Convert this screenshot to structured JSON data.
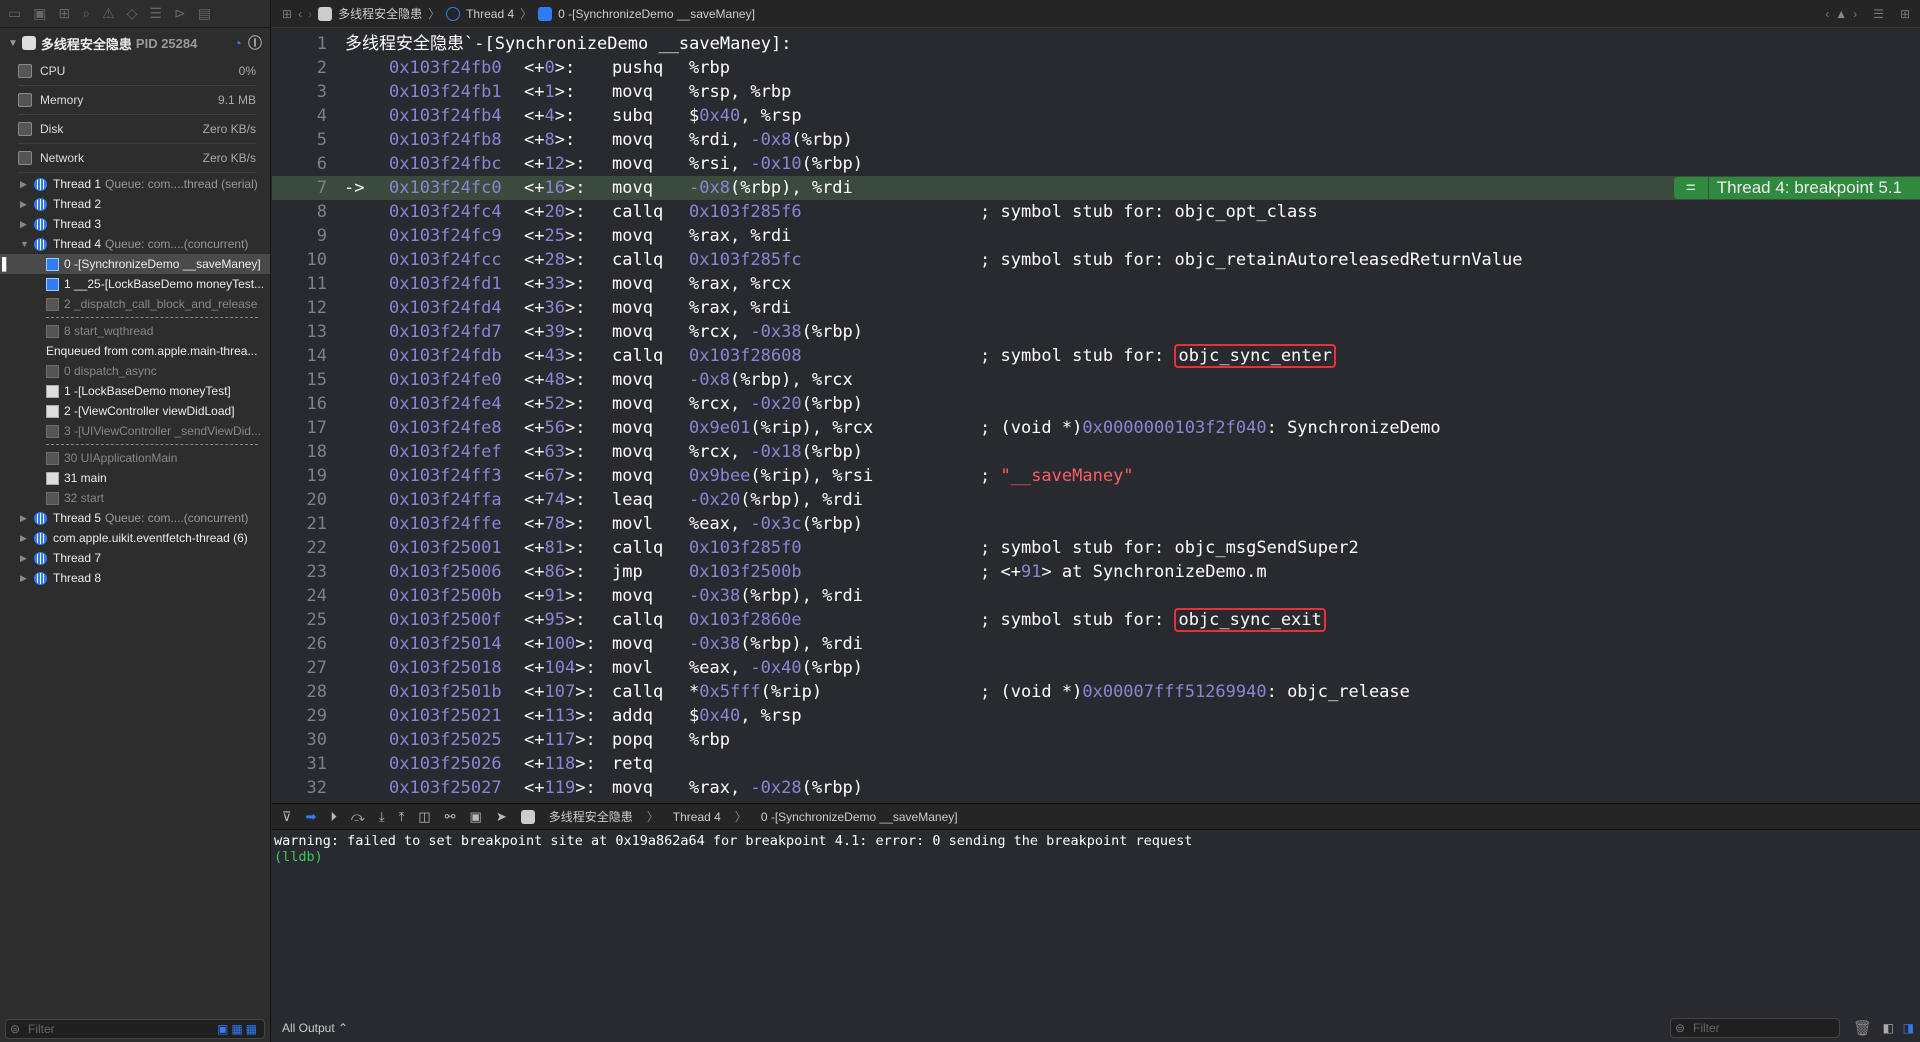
{
  "process": {
    "name": "多线程安全隐患",
    "pid": "PID 25284"
  },
  "gauges": [
    {
      "label": "CPU",
      "value": "0%"
    },
    {
      "label": "Memory",
      "value": "9.1 MB"
    },
    {
      "label": "Disk",
      "value": "Zero KB/s"
    },
    {
      "label": "Network",
      "value": "Zero KB/s"
    }
  ],
  "threads": [
    {
      "kind": "thread",
      "label": "Thread 1",
      "queue": "Queue: com....thread (serial)",
      "expanded": false
    },
    {
      "kind": "thread",
      "label": "Thread 2",
      "queue": "",
      "expanded": false
    },
    {
      "kind": "thread",
      "label": "Thread 3",
      "queue": "",
      "expanded": false
    },
    {
      "kind": "thread",
      "label": "Thread 4",
      "queue": "Queue: com....(concurrent)",
      "expanded": true
    },
    {
      "kind": "frame",
      "type": "user",
      "label": "0 -[SynchronizeDemo __saveManey]",
      "selected": true
    },
    {
      "kind": "frame",
      "type": "user",
      "label": "1 __25-[LockBaseDemo moneyTest..."
    },
    {
      "kind": "frame",
      "type": "sys",
      "label": "2 _dispatch_call_block_and_release"
    },
    {
      "kind": "dash"
    },
    {
      "kind": "frame",
      "type": "sys",
      "label": "8 start_wqthread"
    },
    {
      "kind": "enq",
      "label": "Enqueued from com.apple.main-threa..."
    },
    {
      "kind": "frame",
      "type": "sys",
      "label": "0 dispatch_async"
    },
    {
      "kind": "frame",
      "type": "app",
      "label": "1 -[LockBaseDemo moneyTest]"
    },
    {
      "kind": "frame",
      "type": "app",
      "label": "2 -[ViewController viewDidLoad]"
    },
    {
      "kind": "frame",
      "type": "sys",
      "label": "3 -[UIViewController _sendViewDid..."
    },
    {
      "kind": "dash"
    },
    {
      "kind": "frame",
      "type": "sys",
      "label": "30 UIApplicationMain"
    },
    {
      "kind": "frame",
      "type": "app",
      "label": "31 main"
    },
    {
      "kind": "frame",
      "type": "sys",
      "label": "32 start"
    },
    {
      "kind": "thread",
      "label": "Thread 5",
      "queue": "Queue: com....(concurrent)",
      "expanded": false
    },
    {
      "kind": "thread",
      "label": "com.apple.uikit.eventfetch-thread (6)",
      "queue": "",
      "expanded": false
    },
    {
      "kind": "thread",
      "label": "Thread 7",
      "queue": "",
      "expanded": false
    },
    {
      "kind": "thread",
      "label": "Thread 8",
      "queue": "",
      "expanded": false
    }
  ],
  "sidebar_filter_placeholder": "Filter",
  "breadcrumb": {
    "app": "多线程安全隐患",
    "thread": "Thread 4",
    "frame": "0 -[SynchronizeDemo __saveManey]"
  },
  "code": {
    "header": "多线程安全隐患`-[SynchronizeDemo __saveManey]:",
    "current_line": 7,
    "breakpoint_label": "Thread 4: breakpoint 5.1",
    "lines": [
      [
        "0x103f24fb0",
        "<+0>:",
        "pushq",
        "%rbp",
        ""
      ],
      [
        "0x103f24fb1",
        "<+1>:",
        "movq",
        "%rsp, %rbp",
        ""
      ],
      [
        "0x103f24fb4",
        "<+4>:",
        "subq",
        "$0x40, %rsp",
        ""
      ],
      [
        "0x103f24fb8",
        "<+8>:",
        "movq",
        "%rdi, -0x8(%rbp)",
        ""
      ],
      [
        "0x103f24fbc",
        "<+12>:",
        "movq",
        "%rsi, -0x10(%rbp)",
        ""
      ],
      [
        "0x103f24fc0",
        "<+16>:",
        "movq",
        "-0x8(%rbp), %rdi",
        ""
      ],
      [
        "0x103f24fc4",
        "<+20>:",
        "callq",
        "0x103f285f6",
        "; symbol stub for: objc_opt_class"
      ],
      [
        "0x103f24fc9",
        "<+25>:",
        "movq",
        "%rax, %rdi",
        ""
      ],
      [
        "0x103f24fcc",
        "<+28>:",
        "callq",
        "0x103f285fc",
        "; symbol stub for: objc_retainAutoreleasedReturnValue"
      ],
      [
        "0x103f24fd1",
        "<+33>:",
        "movq",
        "%rax, %rcx",
        ""
      ],
      [
        "0x103f24fd4",
        "<+36>:",
        "movq",
        "%rax, %rdi",
        ""
      ],
      [
        "0x103f24fd7",
        "<+39>:",
        "movq",
        "%rcx, -0x38(%rbp)",
        ""
      ],
      [
        "0x103f24fdb",
        "<+43>:",
        "callq",
        "0x103f28608",
        "; symbol stub for: objc_sync_enter"
      ],
      [
        "0x103f24fe0",
        "<+48>:",
        "movq",
        "-0x8(%rbp), %rcx",
        ""
      ],
      [
        "0x103f24fe4",
        "<+52>:",
        "movq",
        "%rcx, -0x20(%rbp)",
        ""
      ],
      [
        "0x103f24fe8",
        "<+56>:",
        "movq",
        "0x9e01(%rip), %rcx",
        "; (void *)0x0000000103f2f040: SynchronizeDemo"
      ],
      [
        "0x103f24fef",
        "<+63>:",
        "movq",
        "%rcx, -0x18(%rbp)",
        ""
      ],
      [
        "0x103f24ff3",
        "<+67>:",
        "movq",
        "0x9bee(%rip), %rsi",
        "; \"__saveManey\""
      ],
      [
        "0x103f24ffa",
        "<+74>:",
        "leaq",
        "-0x20(%rbp), %rdi",
        ""
      ],
      [
        "0x103f24ffe",
        "<+78>:",
        "movl",
        "%eax, -0x3c(%rbp)",
        ""
      ],
      [
        "0x103f25001",
        "<+81>:",
        "callq",
        "0x103f285f0",
        "; symbol stub for: objc_msgSendSuper2"
      ],
      [
        "0x103f25006",
        "<+86>:",
        "jmp",
        "0x103f2500b",
        "; <+91> at SynchronizeDemo.m"
      ],
      [
        "0x103f2500b",
        "<+91>:",
        "movq",
        "-0x38(%rbp), %rdi",
        ""
      ],
      [
        "0x103f2500f",
        "<+95>:",
        "callq",
        "0x103f2860e",
        "; symbol stub for: objc_sync_exit"
      ],
      [
        "0x103f25014",
        "<+100>:",
        "movq",
        "-0x38(%rbp), %rdi",
        ""
      ],
      [
        "0x103f25018",
        "<+104>:",
        "movl",
        "%eax, -0x40(%rbp)",
        ""
      ],
      [
        "0x103f2501b",
        "<+107>:",
        "callq",
        "*0x5fff(%rip)",
        "; (void *)0x00007fff51269940: objc_release"
      ],
      [
        "0x103f25021",
        "<+113>:",
        "addq",
        "$0x40, %rsp",
        ""
      ],
      [
        "0x103f25025",
        "<+117>:",
        "popq",
        "%rbp",
        ""
      ],
      [
        "0x103f25026",
        "<+118>:",
        "retq",
        "",
        ""
      ],
      [
        "0x103f25027",
        "<+119>:",
        "movq",
        "%rax, -0x28(%rbp)",
        ""
      ]
    ],
    "highlighted_symbols": [
      "objc_sync_enter",
      "objc_sync_exit"
    ]
  },
  "console": {
    "warning": "warning: failed to set breakpoint site at 0x19a862a64 for breakpoint 4.1: error: 0 sending the breakpoint request",
    "prompt": "(lldb)"
  },
  "bottom": {
    "output_selector": "All Output",
    "filter_placeholder": "Filter"
  },
  "colors": {
    "address": "#8f84d4",
    "current_line": "#3a4a3c",
    "breakpoint": "#2f8a3e",
    "highlight_box": "#e8303d",
    "prompt": "#3fc55a",
    "string": "#fc5f5f"
  }
}
